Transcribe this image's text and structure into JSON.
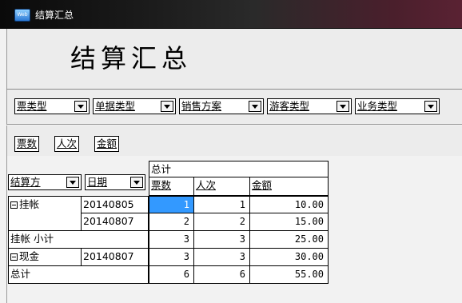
{
  "window": {
    "title": "结算汇总",
    "icon_text": "Web"
  },
  "page_title": "结算汇总",
  "filters": [
    {
      "label": "票类型"
    },
    {
      "label": "单据类型"
    },
    {
      "label": "销售方案"
    },
    {
      "label": "游客类型"
    },
    {
      "label": "业务类型"
    }
  ],
  "measures": [
    "票数",
    "人次",
    "金额"
  ],
  "row_fields": [
    "结算方",
    "日期"
  ],
  "column_group": "总计",
  "columns": [
    "票数",
    "人次",
    "金额"
  ],
  "rows": [
    {
      "group": "挂帐",
      "date": "20140805",
      "count": "1",
      "persons": "1",
      "amount": "10.00"
    },
    {
      "group": "",
      "date": "20140807",
      "count": "2",
      "persons": "2",
      "amount": "15.00"
    },
    {
      "subtotal_label": "挂帐 小计",
      "count": "3",
      "persons": "3",
      "amount": "25.00"
    },
    {
      "group": "现金",
      "date": "20140807",
      "count": "3",
      "persons": "3",
      "amount": "30.00"
    },
    {
      "total_label": "总计",
      "count": "6",
      "persons": "6",
      "amount": "55.00"
    }
  ]
}
